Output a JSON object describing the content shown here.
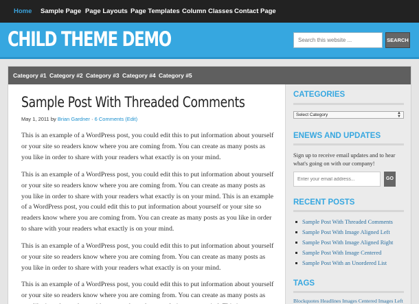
{
  "topnav": {
    "items": [
      "Home",
      "Sample Page",
      "Page Layouts",
      "Page Templates",
      "Column Classes",
      "Contact Page"
    ]
  },
  "header": {
    "site_title": "CHILD THEME DEMO",
    "search_placeholder": "Search this website ...",
    "search_button": "SEARCH"
  },
  "subnav": {
    "categories": [
      "Category #1",
      "Category #2",
      "Category #3",
      "Category #4",
      "Category #5"
    ]
  },
  "post": {
    "title": "Sample Post With Threaded Comments",
    "date": "May 1, 2011",
    "by": " by ",
    "author": "Brian Gardner",
    "sep": " · ",
    "comments": "6 Comments",
    "edit": "(Edit)",
    "paragraphs": [
      "This is an example of a WordPress post, you could edit this to put information about yourself or your site so readers know where you are coming from. You can create as many posts as you like in order to share with your readers what exactly is on your mind.",
      "This is an example of a WordPress post, you could edit this to put information about yourself or your site so readers know where you are coming from. You can create as many posts as you like in order to share with your readers what exactly is on your mind. This is an example of a WordPress post, you could edit this to put information about yourself or your site so readers know where you are coming from. You can create as many posts as you like in order to share with your readers what exactly is on your mind.",
      "This is an example of a WordPress post, you could edit this to put information about yourself or your site so readers know where you are coming from. You can create as many posts as you like in order to share with your readers what exactly is on your mind.",
      "This is an example of a WordPress post, you could edit this to put information about yourself or your site so readers know where you are coming from. You can create as many posts as you like in order to share with your readers what exactly is on your mind. This is"
    ]
  },
  "sidebar": {
    "categories_heading": "CATEGORIES",
    "category_select": "Select Category",
    "enews_heading": "ENEWS AND UPDATES",
    "enews_text": "Sign up to receive email updates and to hear what's going on with our company!",
    "email_placeholder": "Enter your email address...",
    "go_button": "GO",
    "recent_heading": "RECENT POSTS",
    "recent_posts": [
      "Sample Post With Threaded Comments",
      "Sample Post With Image Aligned Left",
      "Sample Post With Image Aligned Right",
      "Sample Post With Image Centered",
      "Sample Post With an Unordered List"
    ],
    "tags_heading": "TAGS",
    "tags_text": "Blockquotes Headlines Images Centered Images Left"
  },
  "colors": {
    "accent": "#36a7e0",
    "topnav_bg": "#222222",
    "subnav_bg": "#5f5f5f",
    "sidebar_bg": "#ebebeb"
  }
}
